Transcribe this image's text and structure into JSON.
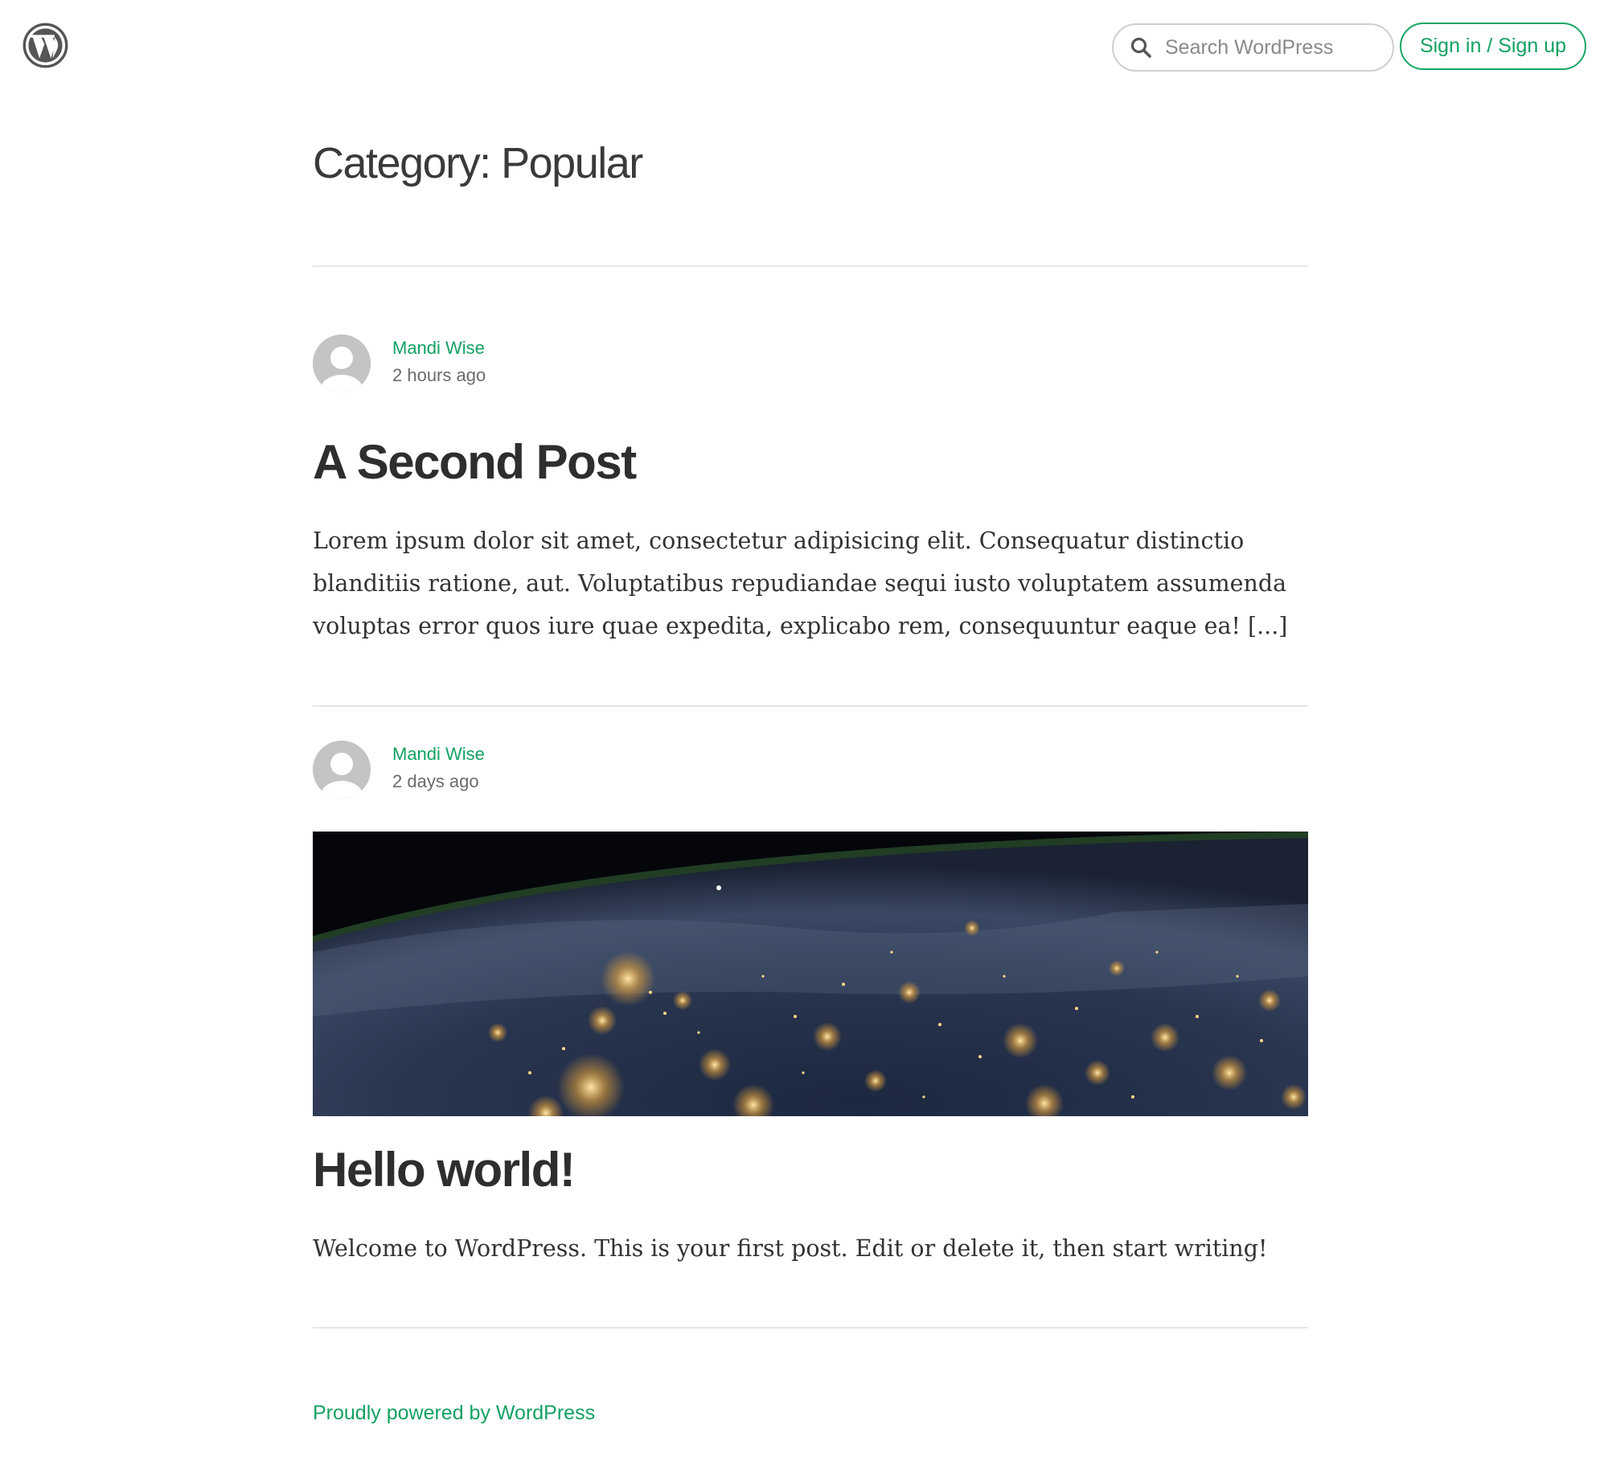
{
  "header": {
    "logo_icon": "wordpress-logo-icon",
    "search": {
      "icon": "search-icon",
      "placeholder": "Search WordPress",
      "value": ""
    },
    "signin_label": "Sign in / Sign up"
  },
  "page": {
    "title": "Category: Popular"
  },
  "posts": [
    {
      "author": "Mandi Wise",
      "time": "2 hours ago",
      "title": "A Second Post",
      "excerpt": "Lorem ipsum dolor sit amet, consectetur adipisicing elit. Consequatur distinctio blanditiis ratione, aut. Voluptatibus repudiandae sequi iusto voluptatem assumenda voluptas error quos iure quae expedita, explicabo rem, consequuntur eaque ea! [...]"
    },
    {
      "author": "Mandi Wise",
      "time": "2 days ago",
      "image": "earth-at-night-photo",
      "title": "Hello world!",
      "excerpt": "Welcome to WordPress. This is your first post. Edit or delete it, then start writing!"
    }
  ],
  "footer": {
    "link": "Proudly powered by WordPress"
  },
  "colors": {
    "accent": "#13a161",
    "text": "#333333",
    "divider": "#e6e6e6"
  }
}
